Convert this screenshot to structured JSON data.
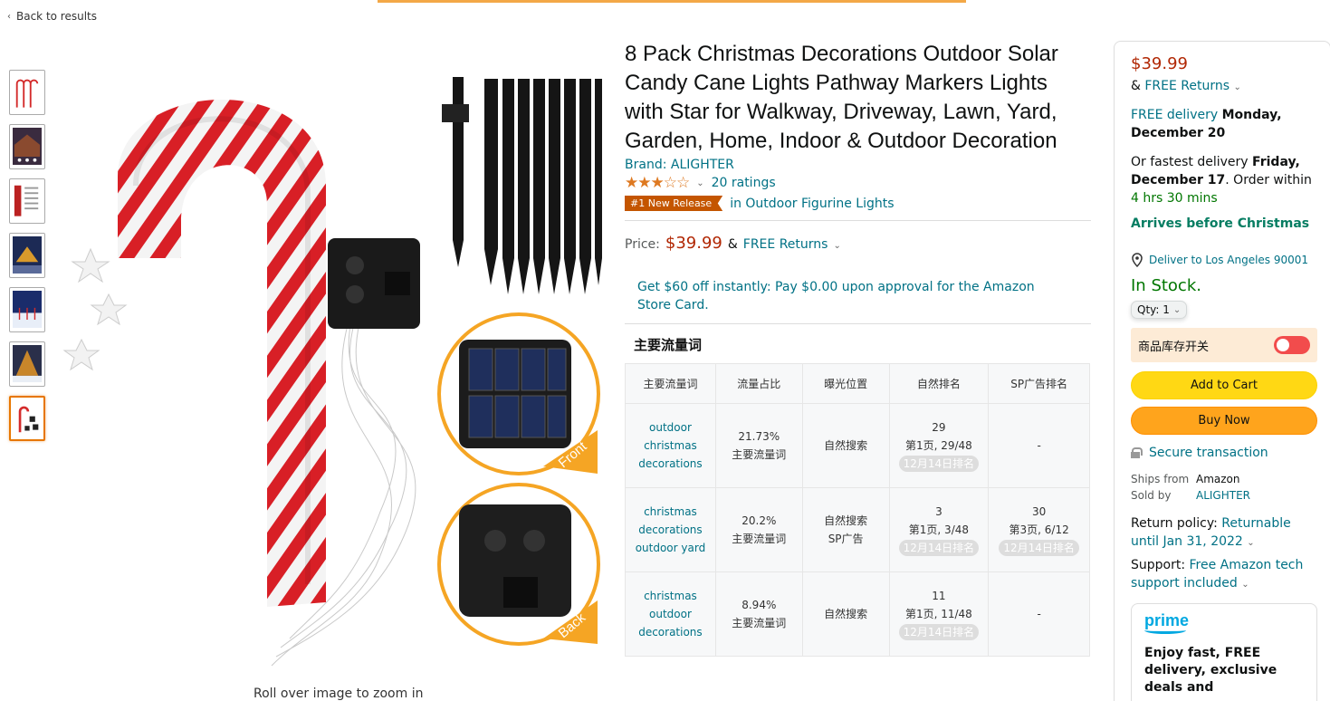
{
  "nav": {
    "back_label": "Back to results"
  },
  "gallery": {
    "zoom_note": "Roll over image to zoom in",
    "thumbnails": [
      "candy-cane-set",
      "house-lights",
      "spec-sheet",
      "night-scene",
      "snow-scene",
      "christmas-tree",
      "candy-cane-parts"
    ],
    "image_labels": {
      "front": "Front",
      "back": "Back"
    }
  },
  "product": {
    "title": "8 Pack Christmas Decorations Outdoor Solar Candy Cane Lights Pathway Markers Lights with Star for Walkway, Driveway, Lawn, Yard, Garden, Home, Indoor & Outdoor Decoration",
    "brand": "Brand: ALIGHTER",
    "rating_stars": 3.5,
    "ratings": "20 ratings",
    "badge": "#1 New Release",
    "badge_category": "in Outdoor Figurine Lights",
    "price_label": "Price:",
    "price": "$39.99",
    "price_and": "&",
    "free_returns": "FREE Returns",
    "promo": "Get $60 off instantly: Pay $0.00 upon approval for the Amazon Store Card."
  },
  "keywords": {
    "title": "主要流量词",
    "headers": [
      "主要流量词",
      "流量占比",
      "曝光位置",
      "自然排名",
      "SP广告排名"
    ],
    "rows": [
      {
        "keyword": "outdoor christmas decorations",
        "share": "21.73%",
        "share_note": "主要流量词",
        "exposure": "自然搜索",
        "natural_rank": "29",
        "natural_page": "第1页, 29/48",
        "natural_tag": "12月14日排名",
        "sp_rank": "-",
        "sp_page": "",
        "sp_tag": ""
      },
      {
        "keyword": "christmas decorations outdoor yard",
        "share": "20.2%",
        "share_note": "主要流量词",
        "exposure": "自然搜索 SP广告",
        "natural_rank": "3",
        "natural_page": "第1页, 3/48",
        "natural_tag": "12月14日排名",
        "sp_rank": "30",
        "sp_page": "第3页, 6/12",
        "sp_tag": "12月14日排名"
      },
      {
        "keyword": "christmas outdoor decorations",
        "share": "8.94%",
        "share_note": "主要流量词",
        "exposure": "自然搜索",
        "natural_rank": "11",
        "natural_page": "第1页, 11/48",
        "natural_tag": "12月14日排名",
        "sp_rank": "-",
        "sp_page": "",
        "sp_tag": ""
      }
    ]
  },
  "buybox": {
    "price": "$39.99",
    "and": "&",
    "free_returns": "FREE Returns",
    "free_delivery": "FREE delivery",
    "delivery_date": "Monday, December 20",
    "fastest_prefix": "Or fastest delivery",
    "fastest_date": "Friday, December 17",
    "order_within": ". Order within",
    "order_time": "4 hrs 30 mins",
    "arrives": "Arrives before Christmas",
    "deliver_to": "Deliver to Los Angeles 90001",
    "in_stock": "In Stock.",
    "qty_label": "Qty: 1",
    "stock_toggle_label": "商品库存开关",
    "add_to_cart": "Add to Cart",
    "buy_now": "Buy Now",
    "secure": "Secure transaction",
    "ships_from_label": "Ships from",
    "ships_from": "Amazon",
    "sold_by_label": "Sold by",
    "sold_by": "ALIGHTER",
    "return_label": "Return policy:",
    "return_value": "Returnable until Jan 31, 2022",
    "support_label": "Support:",
    "support_value": "Free Amazon tech support included",
    "prime_logo": "prime",
    "prime_text": "Enjoy fast, FREE delivery, exclusive deals and"
  },
  "colors": {
    "accent": "#f3a847",
    "link": "#007185",
    "price": "#b12704",
    "in_stock": "#007600",
    "add_to_cart": "#ffd814",
    "buy_now": "#ffa41c",
    "toggle": "#f24c4c"
  }
}
